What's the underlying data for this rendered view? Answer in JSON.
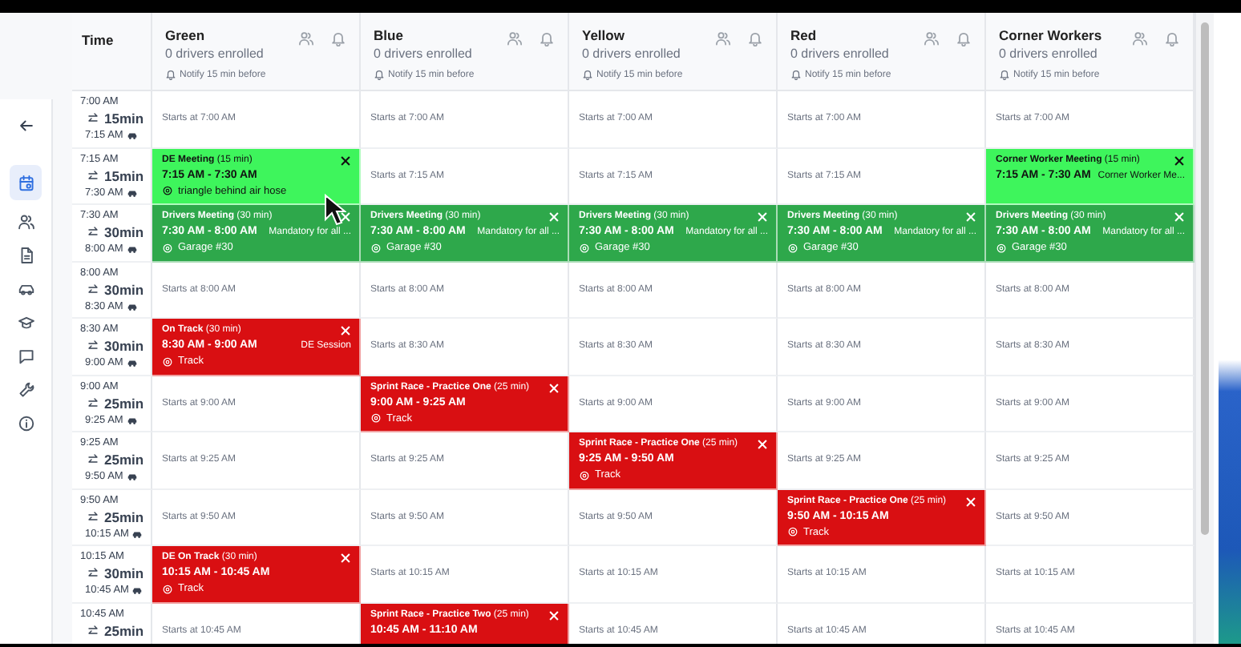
{
  "sidebar": {
    "items": [
      {
        "selected": false
      },
      {
        "selected": true
      },
      {
        "selected": false
      },
      {
        "selected": false
      },
      {
        "selected": false
      },
      {
        "selected": false
      },
      {
        "selected": false
      },
      {
        "selected": false
      },
      {
        "selected": false
      }
    ]
  },
  "time_header": "Time",
  "columns": [
    {
      "name": "Green",
      "enrolled": "0 drivers enrolled",
      "notify": "Notify 15 min before"
    },
    {
      "name": "Blue",
      "enrolled": "0 drivers enrolled",
      "notify": "Notify 15 min before"
    },
    {
      "name": "Yellow",
      "enrolled": "0 drivers enrolled",
      "notify": "Notify 15 min before"
    },
    {
      "name": "Red",
      "enrolled": "0 drivers enrolled",
      "notify": "Notify 15 min before"
    },
    {
      "name": "Corner Workers",
      "enrolled": "0 drivers enrolled",
      "notify": "Notify 15 min before"
    }
  ],
  "rows": [
    {
      "start": "7:00 AM",
      "duration": "15min",
      "end": "7:15 AM",
      "cells": [
        {
          "kind": "open",
          "text": "Starts at 7:00 AM"
        },
        {
          "kind": "open",
          "text": "Starts at 7:00 AM"
        },
        {
          "kind": "open",
          "text": "Starts at 7:00 AM"
        },
        {
          "kind": "open",
          "text": "Starts at 7:00 AM"
        },
        {
          "kind": "open",
          "text": "Starts at 7:00 AM"
        }
      ]
    },
    {
      "start": "7:15 AM",
      "duration": "15min",
      "end": "7:30 AM",
      "cells": [
        {
          "kind": "event",
          "title": "DE Meeting",
          "length": "(15 min)",
          "time": "7:15 AM - 7:30 AM",
          "location": "triangle behind air hose",
          "color": "#3ef55c"
        },
        {
          "kind": "open",
          "text": "Starts at 7:15 AM"
        },
        {
          "kind": "open",
          "text": "Starts at 7:15 AM"
        },
        {
          "kind": "open",
          "text": "Starts at 7:15 AM"
        },
        {
          "kind": "event",
          "title": "Corner Worker Meeting",
          "length": "(15 min)",
          "time": "7:15 AM - 7:30 AM",
          "note": "Corner Worker Me...",
          "color": "#3ef55c"
        }
      ]
    },
    {
      "start": "7:30 AM",
      "duration": "30min",
      "end": "8:00 AM",
      "cells": [
        {
          "kind": "event",
          "title": "Drivers Meeting",
          "length": "(30 min)",
          "time": "7:30 AM - 8:00 AM",
          "note": "Mandatory for all ...",
          "location": "Garage #30",
          "color": "#2ea84b"
        },
        {
          "kind": "event",
          "title": "Drivers Meeting",
          "length": "(30 min)",
          "time": "7:30 AM - 8:00 AM",
          "note": "Mandatory for all ...",
          "location": "Garage #30",
          "color": "#2ea84b"
        },
        {
          "kind": "event",
          "title": "Drivers Meeting",
          "length": "(30 min)",
          "time": "7:30 AM - 8:00 AM",
          "note": "Mandatory for all ...",
          "location": "Garage #30",
          "color": "#2ea84b"
        },
        {
          "kind": "event",
          "title": "Drivers Meeting",
          "length": "(30 min)",
          "time": "7:30 AM - 8:00 AM",
          "note": "Mandatory for all ...",
          "location": "Garage #30",
          "color": "#2ea84b"
        },
        {
          "kind": "event",
          "title": "Drivers Meeting",
          "length": "(30 min)",
          "time": "7:30 AM - 8:00 AM",
          "note": "Mandatory for all ...",
          "location": "Garage #30",
          "color": "#2ea84b"
        }
      ]
    },
    {
      "start": "8:00 AM",
      "duration": "30min",
      "end": "8:30 AM",
      "cells": [
        {
          "kind": "open",
          "text": "Starts at 8:00 AM"
        },
        {
          "kind": "open",
          "text": "Starts at 8:00 AM"
        },
        {
          "kind": "open",
          "text": "Starts at 8:00 AM"
        },
        {
          "kind": "open",
          "text": "Starts at 8:00 AM"
        },
        {
          "kind": "open",
          "text": "Starts at 8:00 AM"
        }
      ]
    },
    {
      "start": "8:30 AM",
      "duration": "30min",
      "end": "9:00 AM",
      "cells": [
        {
          "kind": "event",
          "title": "On Track",
          "length": "(30 min)",
          "time": "8:30 AM - 9:00 AM",
          "note": "DE Session",
          "location": "Track",
          "color": "#d90f12"
        },
        {
          "kind": "open",
          "text": "Starts at 8:30 AM"
        },
        {
          "kind": "open",
          "text": "Starts at 8:30 AM"
        },
        {
          "kind": "open",
          "text": "Starts at 8:30 AM"
        },
        {
          "kind": "open",
          "text": "Starts at 8:30 AM"
        }
      ]
    },
    {
      "start": "9:00 AM",
      "duration": "25min",
      "end": "9:25 AM",
      "cells": [
        {
          "kind": "open",
          "text": "Starts at 9:00 AM"
        },
        {
          "kind": "event",
          "title": "Sprint Race - Practice One",
          "length": "(25 min)",
          "time": "9:00 AM - 9:25 AM",
          "location": "Track",
          "color": "#d90f12"
        },
        {
          "kind": "open",
          "text": "Starts at 9:00 AM"
        },
        {
          "kind": "open",
          "text": "Starts at 9:00 AM"
        },
        {
          "kind": "open",
          "text": "Starts at 9:00 AM"
        }
      ]
    },
    {
      "start": "9:25 AM",
      "duration": "25min",
      "end": "9:50 AM",
      "cells": [
        {
          "kind": "open",
          "text": "Starts at 9:25 AM"
        },
        {
          "kind": "open",
          "text": "Starts at 9:25 AM"
        },
        {
          "kind": "event",
          "title": "Sprint Race - Practice One",
          "length": "(25 min)",
          "time": "9:25 AM - 9:50 AM",
          "location": "Track",
          "color": "#d90f12"
        },
        {
          "kind": "open",
          "text": "Starts at 9:25 AM"
        },
        {
          "kind": "open",
          "text": "Starts at 9:25 AM"
        }
      ]
    },
    {
      "start": "9:50 AM",
      "duration": "25min",
      "end": "10:15 AM",
      "cells": [
        {
          "kind": "open",
          "text": "Starts at 9:50 AM"
        },
        {
          "kind": "open",
          "text": "Starts at 9:50 AM"
        },
        {
          "kind": "open",
          "text": "Starts at 9:50 AM"
        },
        {
          "kind": "event",
          "title": "Sprint Race - Practice One",
          "length": "(25 min)",
          "time": "9:50 AM - 10:15 AM",
          "location": "Track",
          "color": "#d90f12"
        },
        {
          "kind": "open",
          "text": "Starts at 9:50 AM"
        }
      ]
    },
    {
      "start": "10:15 AM",
      "duration": "30min",
      "end": "10:45 AM",
      "cells": [
        {
          "kind": "event",
          "title": "DE On Track",
          "length": "(30 min)",
          "time": "10:15 AM - 10:45 AM",
          "location": "Track",
          "color": "#d90f12"
        },
        {
          "kind": "open",
          "text": "Starts at 10:15 AM"
        },
        {
          "kind": "open",
          "text": "Starts at 10:15 AM"
        },
        {
          "kind": "open",
          "text": "Starts at 10:15 AM"
        },
        {
          "kind": "open",
          "text": "Starts at 10:15 AM"
        }
      ]
    },
    {
      "start": "10:45 AM",
      "duration": "25min",
      "cells": [
        {
          "kind": "open",
          "text": "Starts at 10:45 AM"
        },
        {
          "kind": "event",
          "title": "Sprint Race - Practice Two",
          "length": "(25 min)",
          "time": "10:45 AM - 11:10 AM",
          "color": "#d90f12"
        },
        {
          "kind": "open",
          "text": "Starts at 10:45 AM"
        },
        {
          "kind": "open",
          "text": "Starts at 10:45 AM"
        },
        {
          "kind": "open",
          "text": "Starts at 10:45 AM"
        }
      ]
    }
  ]
}
